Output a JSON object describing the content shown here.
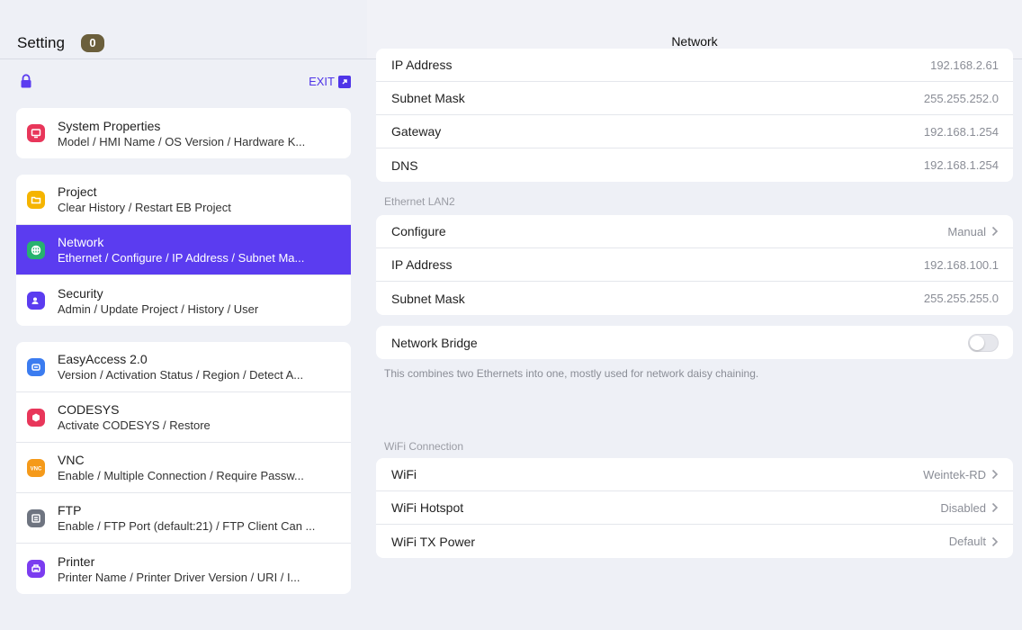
{
  "sidebar": {
    "title": "Setting",
    "badge": "0",
    "exit_label": "EXIT",
    "groups": [
      [
        {
          "label": "System Properties",
          "sub": "Model / HMI Name / OS Version / Hardware K...",
          "color": "#e8365a",
          "icon": "monitor-icon"
        }
      ],
      [
        {
          "label": "Project",
          "sub": "Clear History / Restart EB Project",
          "color": "#f5b400",
          "icon": "folder-icon"
        },
        {
          "label": "Network",
          "sub": "Ethernet / Configure / IP Address / Subnet Ma...",
          "color": "#27b26f",
          "icon": "globe-icon"
        },
        {
          "label": "Security",
          "sub": "Admin / Update Project / History / User",
          "color": "#5b3cf0",
          "icon": "user-shield-icon"
        }
      ],
      [
        {
          "label": "EasyAccess 2.0",
          "sub": "Version / Activation Status / Region / Detect A...",
          "color": "#3b7cf0",
          "icon": "easyaccess-icon"
        },
        {
          "label": "CODESYS",
          "sub": "Activate CODESYS / Restore",
          "color": "#e8365a",
          "icon": "codesys-icon"
        },
        {
          "label": "VNC",
          "sub": "Enable / Multiple Connection / Require Passw...",
          "color": "#f59a1a",
          "icon": "vnc-icon"
        },
        {
          "label": "FTP",
          "sub": "Enable / FTP Port (default:21) / FTP Client Can ...",
          "color": "#6e7480",
          "icon": "ftp-icon"
        },
        {
          "label": "Printer",
          "sub": "Printer Name / Printer Driver Version / URI / I...",
          "color": "#7b3cf0",
          "icon": "printer-icon"
        }
      ]
    ]
  },
  "main": {
    "title": "Network",
    "lan1_rows": [
      {
        "label": "IP Address",
        "value": "192.168.2.61"
      },
      {
        "label": "Subnet Mask",
        "value": "255.255.252.0"
      },
      {
        "label": "Gateway",
        "value": "192.168.1.254"
      },
      {
        "label": "DNS",
        "value": "192.168.1.254"
      }
    ],
    "lan2_section": "Ethernet LAN2",
    "lan2_rows": [
      {
        "label": "Configure",
        "value": "Manual",
        "chevron": true
      },
      {
        "label": "IP Address",
        "value": "192.168.100.1"
      },
      {
        "label": "Subnet Mask",
        "value": "255.255.255.0"
      }
    ],
    "bridge": {
      "label": "Network Bridge",
      "enabled": false,
      "note": "This combines two Ethernets into one, mostly used for network daisy chaining."
    },
    "wifi_section": "WiFi Connection",
    "wifi_rows": [
      {
        "label": "WiFi",
        "value": "Weintek-RD"
      },
      {
        "label": "WiFi Hotspot",
        "value": "Disabled"
      },
      {
        "label": "WiFi TX Power",
        "value": "Default"
      }
    ]
  }
}
